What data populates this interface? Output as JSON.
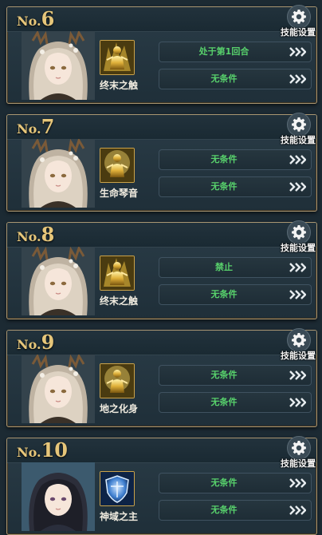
{
  "settings_label": "技能设置",
  "cards": [
    {
      "prefix": "No.",
      "number": "6",
      "skill": "终末之触",
      "skill_icon": "golden-warrior-aura-icon",
      "conditions": [
        "处于第1回合",
        "无条件"
      ],
      "portrait": "silver-haired-woman"
    },
    {
      "prefix": "No.",
      "number": "7",
      "skill": "生命琴音",
      "skill_icon": "golden-warrior-icon",
      "conditions": [
        "无条件",
        "无条件"
      ],
      "portrait": "silver-haired-woman"
    },
    {
      "prefix": "No.",
      "number": "8",
      "skill": "终末之触",
      "skill_icon": "golden-warrior-aura-icon",
      "conditions": [
        "禁止",
        "无条件"
      ],
      "portrait": "silver-haired-woman"
    },
    {
      "prefix": "No.",
      "number": "9",
      "skill": "地之化身",
      "skill_icon": "golden-warrior-icon",
      "conditions": [
        "无条件",
        "无条件"
      ],
      "portrait": "silver-haired-woman"
    },
    {
      "prefix": "No.",
      "number": "10",
      "skill": "神域之主",
      "skill_icon": "blue-shield-icon",
      "conditions": [
        "无条件",
        "无条件"
      ],
      "portrait": "dark-haired-woman"
    }
  ],
  "colors": {
    "number_gold": "#e6c67a",
    "condition_green": "#58d26c",
    "frame_gold": "#a99672"
  }
}
